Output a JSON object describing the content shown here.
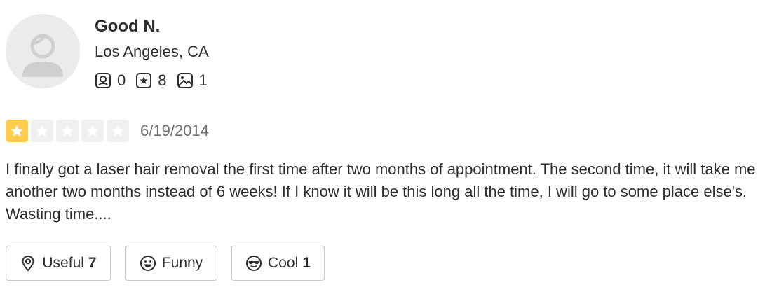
{
  "user": {
    "name": "Good N.",
    "location": "Los Angeles, CA",
    "stats": {
      "friends": "0",
      "reviews": "8",
      "photos": "1"
    }
  },
  "review": {
    "rating": 1,
    "rating_max": 5,
    "date": "6/19/2014",
    "text": "I finally got a laser hair removal the first time after two months of appointment. The second time, it will take me another two months instead of 6 weeks! If I know it will be this long all the time, I will go to some place else's. Wasting time...."
  },
  "reactions": {
    "useful": {
      "label": "Useful",
      "count": "7"
    },
    "funny": {
      "label": "Funny",
      "count": ""
    },
    "cool": {
      "label": "Cool",
      "count": "1"
    }
  },
  "colors": {
    "star_filled": "#ffcc4b",
    "star_empty": "#f0f0f0",
    "text": "#2d2e2f",
    "muted": "#6e7072",
    "border": "#c8c9ca"
  },
  "icons": {
    "avatar": "default-user-avatar-icon",
    "friends": "friends-icon",
    "reviews": "review-star-icon",
    "photos": "photo-icon",
    "useful": "lightbulb-pin-icon",
    "funny": "smile-face-icon",
    "cool": "sunglasses-face-icon"
  }
}
